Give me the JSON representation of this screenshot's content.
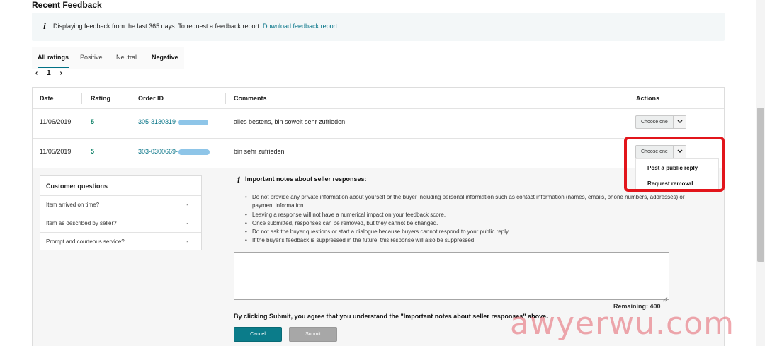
{
  "page": {
    "title": "Recent Feedback"
  },
  "info_box": {
    "icon": "info-icon",
    "text": "Displaying feedback from the last 365 days. To request a feedback report: ",
    "link": "Download feedback report"
  },
  "tabs": [
    {
      "label": "All ratings",
      "active": true
    },
    {
      "label": "Positive",
      "active": false
    },
    {
      "label": "Neutral",
      "active": false
    },
    {
      "label": "Negative",
      "active": false
    }
  ],
  "pager": {
    "prev": "‹",
    "page": "1",
    "next": "›"
  },
  "table": {
    "headers": {
      "date": "Date",
      "rating": "Rating",
      "order_id": "Order ID",
      "comments": "Comments",
      "actions": "Actions"
    },
    "rows": [
      {
        "date": "11/06/2019",
        "rating": "5",
        "order_id": "305-3130319-",
        "comment": "alles bestens, bin soweit sehr zufrieden",
        "action": "Choose one"
      },
      {
        "date": "11/05/2019",
        "rating": "5",
        "order_id": "303-0300669-",
        "comment": "bin sehr zufrieden",
        "action": "Choose one"
      }
    ]
  },
  "dropdown": {
    "items": [
      "Post a public reply",
      "Request removal"
    ]
  },
  "customer_questions": {
    "title": "Customer questions",
    "items": [
      {
        "question": "Item arrived on time?",
        "value": "-"
      },
      {
        "question": "Item as described by seller?",
        "value": "-"
      },
      {
        "question": "Prompt and courteous service?",
        "value": "-"
      }
    ]
  },
  "notes": {
    "icon": "info-icon",
    "title": "Important notes about seller responses:",
    "items": [
      "Do not provide any private information about yourself or the buyer including personal information such as contact information (names, emails, phone numbers, addresses) or payment information.",
      "Leaving a response will not have a numerical impact on your feedback score.",
      "Once submitted, responses can be removed, but they cannot be changed.",
      "Do not ask the buyer questions or start a dialogue because buyers cannot respond to your public reply.",
      "If the buyer's feedback is suppressed in the future, this response will also be suppressed."
    ]
  },
  "reply": {
    "remaining": "Remaining: 400",
    "agreement": "By clicking Submit, you agree that you understand the \"Important notes about seller responses\" above.",
    "cancel_label": "Cancel",
    "submit_label": "Submit"
  },
  "watermark": "awyerwu.com",
  "colors": {
    "accent": "#007185",
    "rating": "#067d62",
    "highlight": "#e2151b",
    "cancel_button": "#0b7c8a"
  }
}
